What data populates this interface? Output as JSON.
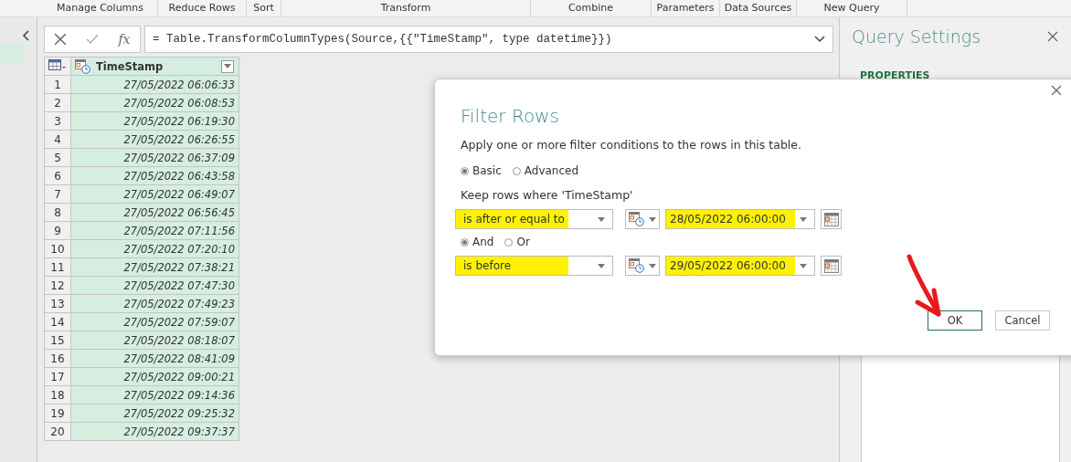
{
  "ribbon_groups": [
    {
      "label": "Manage Columns"
    },
    {
      "label": "Reduce Rows"
    },
    {
      "label": "Sort"
    },
    {
      "label": "Transform"
    },
    {
      "label": "Combine"
    },
    {
      "label": "Parameters"
    },
    {
      "label": "Data Sources"
    },
    {
      "label": "New Query"
    }
  ],
  "formula_bar": {
    "function_label": "fx",
    "formula": "= Table.TransformColumnTypes(Source,{{\"TimeStamp\", type datetime}})"
  },
  "table": {
    "columns": [
      {
        "name": "TimeStamp"
      }
    ],
    "rows": [
      {
        "number": "1",
        "timestamp": "27/05/2022 06:06:33"
      },
      {
        "number": "2",
        "timestamp": "27/05/2022 06:08:53"
      },
      {
        "number": "3",
        "timestamp": "27/05/2022 06:19:30"
      },
      {
        "number": "4",
        "timestamp": "27/05/2022 06:26:55"
      },
      {
        "number": "5",
        "timestamp": "27/05/2022 06:37:09"
      },
      {
        "number": "6",
        "timestamp": "27/05/2022 06:43:58"
      },
      {
        "number": "7",
        "timestamp": "27/05/2022 06:49:07"
      },
      {
        "number": "8",
        "timestamp": "27/05/2022 06:56:45"
      },
      {
        "number": "9",
        "timestamp": "27/05/2022 07:11:56"
      },
      {
        "number": "10",
        "timestamp": "27/05/2022 07:20:10"
      },
      {
        "number": "11",
        "timestamp": "27/05/2022 07:38:21"
      },
      {
        "number": "12",
        "timestamp": "27/05/2022 07:47:30"
      },
      {
        "number": "13",
        "timestamp": "27/05/2022 07:49:23"
      },
      {
        "number": "14",
        "timestamp": "27/05/2022 07:59:07"
      },
      {
        "number": "15",
        "timestamp": "27/05/2022 08:18:07"
      },
      {
        "number": "16",
        "timestamp": "27/05/2022 08:41:09"
      },
      {
        "number": "17",
        "timestamp": "27/05/2022 09:00:21"
      },
      {
        "number": "18",
        "timestamp": "27/05/2022 09:14:36"
      },
      {
        "number": "19",
        "timestamp": "27/05/2022 09:25:32"
      },
      {
        "number": "20",
        "timestamp": "27/05/2022 09:37:37"
      }
    ]
  },
  "query_settings": {
    "title": "Query Settings",
    "section": "PROPERTIES"
  },
  "dialog": {
    "title": "Filter Rows",
    "description": "Apply one or more filter conditions to the rows in this table.",
    "modes": [
      {
        "label": "Basic",
        "selected": true
      },
      {
        "label": "Advanced",
        "selected": false
      }
    ],
    "keep_label": "Keep rows where 'TimeStamp'",
    "conditions": [
      {
        "operator": "is after or equal to",
        "value": "28/05/2022 06:00:00",
        "highlighted": true
      },
      {
        "operator": "is before",
        "value": "29/05/2022 06:00:00",
        "highlighted": true
      }
    ],
    "logic": [
      {
        "label": "And",
        "selected": true
      },
      {
        "label": "Or",
        "selected": false
      }
    ],
    "buttons": [
      {
        "label": "OK",
        "kind": "primary"
      },
      {
        "label": "Cancel",
        "kind": "secondary"
      }
    ]
  }
}
